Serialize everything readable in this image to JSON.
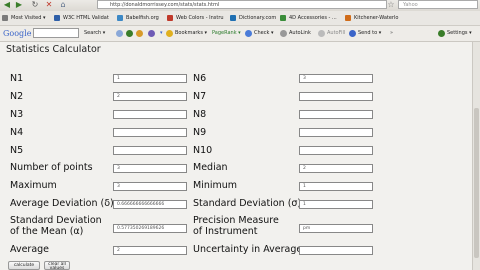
{
  "browser": {
    "url": "http://donaldmorrissey.com/stats/stats.html",
    "search_placeholder": "Yahoo"
  },
  "bookmarks": [
    "Most Visited ▾",
    "W3C HTML Validat",
    "Babelfish.org",
    "Web Colors - Instru",
    "Dictionary.com",
    "4D Accessories - ...",
    "Kitchener-Waterlo"
  ],
  "google_toolbar": {
    "logo": "Google",
    "search_label": "Search ▾",
    "bookmarks_label": "Bookmarks ▾",
    "pagerank_label": "PageRank ▾",
    "check_label": "Check ▾",
    "autolink_label": "AutoLink",
    "autofill_label": "AutoFill",
    "sendto_label": "Send to ▾",
    "settings_label": "Settings ▾"
  },
  "page": {
    "title": "Statistics Calculator",
    "fields": {
      "n1": {
        "label": "N1",
        "value": "1"
      },
      "n2": {
        "label": "N2",
        "value": "2"
      },
      "n3": {
        "label": "N3",
        "value": ""
      },
      "n4": {
        "label": "N4",
        "value": ""
      },
      "n5": {
        "label": "N5",
        "value": ""
      },
      "n6": {
        "label": "N6",
        "value": "3"
      },
      "n7": {
        "label": "N7",
        "value": ""
      },
      "n8": {
        "label": "N8",
        "value": ""
      },
      "n9": {
        "label": "N9",
        "value": ""
      },
      "n10": {
        "label": "N10",
        "value": ""
      },
      "num_points": {
        "label": "Number of points",
        "value": "3"
      },
      "median": {
        "label": "Median",
        "value": "2"
      },
      "maximum": {
        "label": "Maximum",
        "value": "3"
      },
      "minimum": {
        "label": "Minimum",
        "value": "1"
      },
      "avg_dev": {
        "label": "Average Deviation (δ)",
        "value": "0.666666666666666"
      },
      "std_dev": {
        "label": "Standard Deviation (σ)",
        "value": "1"
      },
      "std_dev_mean_1": {
        "label": "Standard Deviation"
      },
      "std_dev_mean_2": {
        "label": "of the Mean (α)",
        "value": "0.577350269189626"
      },
      "precision_1": {
        "label": "Precision Measure"
      },
      "precision_2": {
        "label": "of Instrument",
        "value": "pm"
      },
      "average": {
        "label": "Average",
        "value": "2"
      },
      "uncertainty": {
        "label": "Uncertainty in Average",
        "value": ""
      }
    },
    "buttons": {
      "calculate": "calculate",
      "clear_all": "clear all values"
    }
  },
  "colors": {
    "accent_green": "#3a7d2a",
    "google_blue": "#3b65c9"
  }
}
